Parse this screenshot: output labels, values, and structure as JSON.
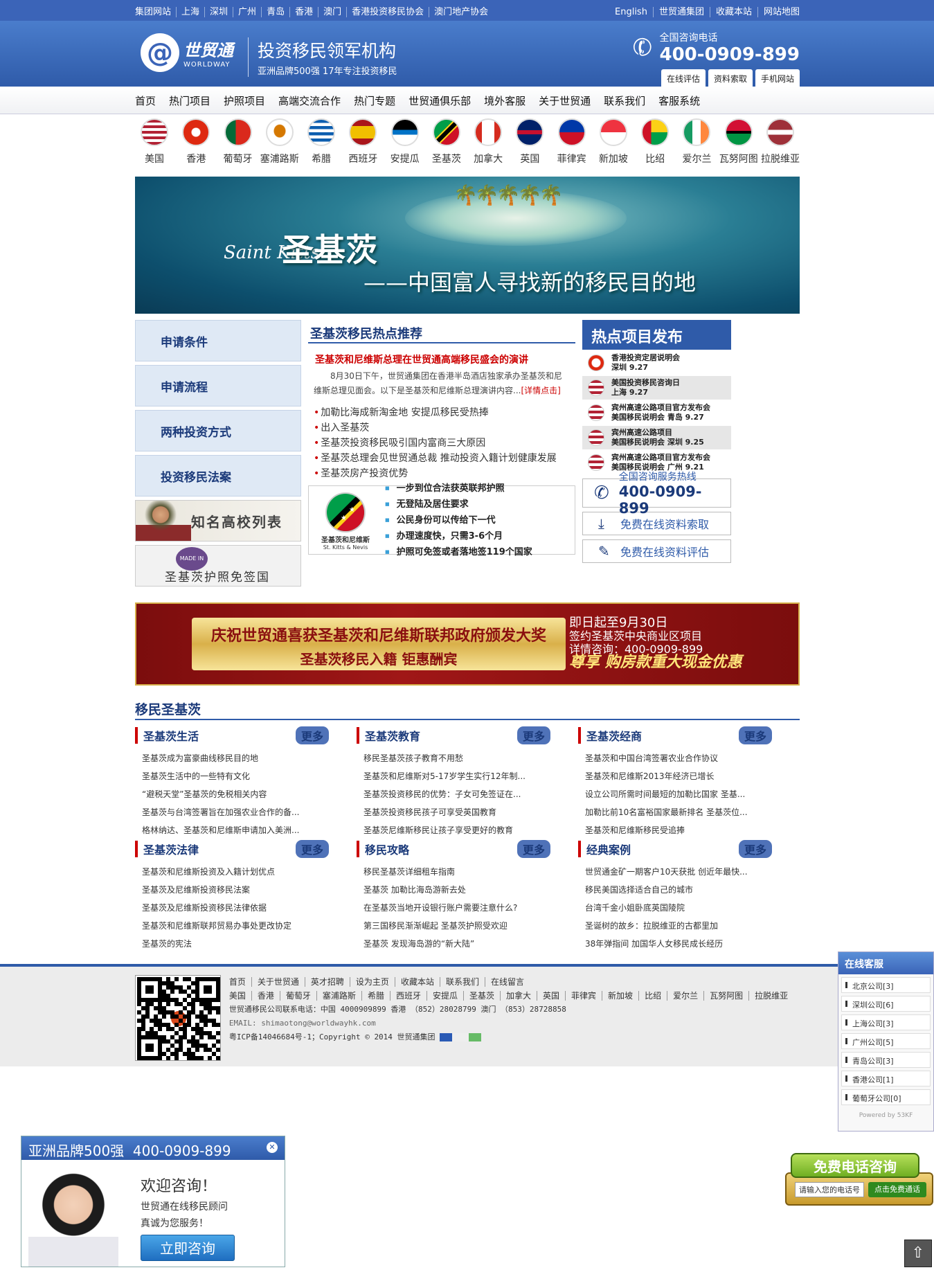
{
  "topbar": {
    "links": [
      "集团网站",
      "上海",
      "深圳",
      "广州",
      "青岛",
      "香港",
      "澳门",
      "香港投资移民协会",
      "澳门地产协会"
    ],
    "right": [
      "English",
      "世贸通集团",
      "收藏本站",
      "网站地图"
    ]
  },
  "header": {
    "logo_zh": "世贸通",
    "logo_en": "WORLDWAY",
    "slogan_main": "投资移民领军机构",
    "slogan_sub": "亚洲品牌500强  17年专注投资移民",
    "hotline_label": "全国咨询电话",
    "hotline_number": "400-0909-899",
    "tabs": [
      "在线评估",
      "资料索取",
      "手机网站"
    ]
  },
  "nav": [
    "首页",
    "热门项目",
    "护照项目",
    "高端交流合作",
    "热门专题",
    "世贸通俱乐部",
    "境外客服",
    "关于世贸通",
    "联系我们",
    "客服系统"
  ],
  "flags": [
    {
      "name": "美国",
      "icon": "us-flag-icon"
    },
    {
      "name": "香港",
      "icon": "hk-flag-icon"
    },
    {
      "name": "葡萄牙",
      "icon": "pt-flag-icon"
    },
    {
      "name": "塞浦路斯",
      "icon": "cy-flag-icon"
    },
    {
      "name": "希腊",
      "icon": "gr-flag-icon"
    },
    {
      "name": "西班牙",
      "icon": "es-flag-icon"
    },
    {
      "name": "安提瓜",
      "icon": "ag-flag-icon"
    },
    {
      "name": "圣基茨",
      "icon": "kn-flag-icon"
    },
    {
      "name": "加拿大",
      "icon": "ca-flag-icon"
    },
    {
      "name": "英国",
      "icon": "gb-flag-icon"
    },
    {
      "name": "菲律宾",
      "icon": "ph-flag-icon"
    },
    {
      "name": "新加坡",
      "icon": "sg-flag-icon"
    },
    {
      "name": "比绍",
      "icon": "gw-flag-icon"
    },
    {
      "name": "爱尔兰",
      "icon": "ie-flag-icon"
    },
    {
      "name": "瓦努阿图",
      "icon": "vu-flag-icon"
    },
    {
      "name": "拉脱维亚",
      "icon": "lv-flag-icon"
    }
  ],
  "banner": {
    "en": "Saint Kitts",
    "title": "圣基茨",
    "subtitle": "——中国富人寻找新的移民目的地"
  },
  "left_menu": [
    "申请条件",
    "申请流程",
    "两种投资方式",
    "投资移民法案"
  ],
  "left_images": {
    "schools": "知名高校列表",
    "visa": "圣基茨护照免签国",
    "stamp": "MADE IN CHINA"
  },
  "center": {
    "title": "圣基茨移民热点推荐",
    "news_title": "圣基茨和尼维斯总理在世贸通高端移民盛会的演讲",
    "news_desc": "8月30日下午，世贸通集团在香港半岛酒店独家承办圣基茨和尼维斯总理见面会。以下是圣基茨和尼维斯总理演讲内容...",
    "news_more": "[详情点击]",
    "list": [
      "加勒比海成新淘金地 安提瓜移民受热捧",
      "出入圣基茨",
      "圣基茨投资移民吸引国内富商三大原因",
      "圣基茨总理会见世贸通总裁 推动投资入籍计划健康发展",
      "圣基茨房产投资优势"
    ],
    "skn_name": "圣基茨和尼维斯",
    "skn_en": "St. Kitts & Nevis",
    "points": [
      "一步到位合法获英联邦护照",
      "无登陆及居住要求",
      "公民身份可以传给下一代",
      "办理速度快，只需3-6个月",
      "护照可免签或者落地签119个国家"
    ]
  },
  "right": {
    "title": "热点项目发布",
    "projects": [
      {
        "l1": "香港投资定居说明会",
        "l2": "深圳 9.27",
        "icon": "hk-flag-icon"
      },
      {
        "l1": "美国投资移民咨询日",
        "l2": "上海 9.27",
        "icon": "us-flag-icon"
      },
      {
        "l1": "宾州高速公路项目官方发布会",
        "l2": "美国移民说明会 青岛 9.27",
        "icon": "us-flag-icon"
      },
      {
        "l1": "宾州高速公路项目",
        "l2": "美国移民说明会 深圳 9.25",
        "icon": "us-flag-icon"
      },
      {
        "l1": "宾州高速公路项目官方发布会",
        "l2": "美国移民说明会 广州 9.21",
        "icon": "us-flag-icon"
      }
    ],
    "svc_label": "全国咨询服务热线",
    "svc_number": "400-0909-899",
    "btn_info": "免费在线资料索取",
    "btn_eval": "免费在线资料评估"
  },
  "promo": {
    "line1": "庆祝世贸通喜获圣基茨和尼维斯联邦政府颁发大奖",
    "line2": "圣基茨移民入籍 钜惠酬宾",
    "r1": "即日起至9月30日",
    "r2": "签约圣基茨中央商业区项目",
    "r3": "详情咨询：400-0909-899",
    "r4": "尊享 购房款重大现金优惠"
  },
  "immi": {
    "title": "移民圣基茨",
    "more": "更多",
    "cols": [
      {
        "title": "圣基茨生活",
        "items": [
          "圣基茨成为富豪曲线移民目的地",
          "圣基茨生活中的一些特有文化",
          "“避税天堂”圣基茨的免税相关内容",
          "圣基茨与台湾签署旨在加强农业合作的备...",
          "格林纳达、圣基茨和尼维斯申请加入美洲..."
        ]
      },
      {
        "title": "圣基茨教育",
        "items": [
          "移民圣基茨孩子教育不用愁",
          "圣基茨和尼维斯对5-17岁学生实行12年制...",
          "圣基茨投资移民的优势：子女可免签证在...",
          "圣基茨投资移民孩子可享受英国教育",
          "圣基茨尼维斯移民让孩子享受更好的教育"
        ]
      },
      {
        "title": "圣基茨经商",
        "items": [
          "圣基茨和中国台湾签署农业合作协议",
          "圣基茨和尼维斯2013年经济已增长",
          "设立公司所需时间最短的加勒比国家 圣基...",
          "加勒比前10名富裕国家最新排名 圣基茨位...",
          "圣基茨和尼维斯移民受追捧"
        ]
      },
      {
        "title": "圣基茨法律",
        "items": [
          "圣基茨和尼维斯投资及入籍计划优点",
          "圣基茨及尼维斯投资移民法案",
          "圣基茨及尼维斯投资移民法律依据",
          "圣基茨和尼维斯联邦贸易办事处更改协定",
          "圣基茨的宪法"
        ]
      },
      {
        "title": "移民攻略",
        "items": [
          "移民圣基茨详细租车指南",
          "圣基茨 加勒比海岛游新去处",
          "在圣基茨当地开设银行账户需要注意什么?",
          "第三国移民渐渐崛起 圣基茨护照受欢迎",
          "圣基茨 发现海岛游的“新大陆”"
        ]
      },
      {
        "title": "经典案例",
        "items": [
          "世贸通金矿一期客户10天获批 创近年最快...",
          "移民美国选择适合自己的城市",
          "台湾千金小姐卧底英国陵院",
          "圣诞树的故乡：拉脱维亚的古都里加",
          "38年弹指间 加国华人女移民成长经历"
        ]
      }
    ]
  },
  "footer": {
    "links": [
      "首页",
      "关于世贸通",
      "英才招聘",
      "设为主页",
      "收藏本站",
      "联系我们",
      "在线留言"
    ],
    "countries": [
      "美国",
      "香港",
      "葡萄牙",
      "塞浦路斯",
      "希腊",
      "西班牙",
      "安提瓜",
      "圣基茨",
      "加拿大",
      "英国",
      "菲律宾",
      "新加坡",
      "比绍",
      "爱尔兰",
      "瓦努阿图",
      "拉脱维亚"
    ],
    "contact": "世贸通移民公司联系电话：中国 4000909899 香港 （852）28028799 澳门 （853）28728858",
    "email": "EMAIL: shimaotong@worldwayhk.com",
    "icp": "粤ICP备14046684号-1；Copyright © 2014 世贸通集团"
  },
  "kf": {
    "title": "在线客服",
    "items": [
      "北京公司[3]",
      "深圳公司[6]",
      "上海公司[3]",
      "广州公司[5]",
      "青岛公司[3]",
      "香港公司[1]",
      "葡萄牙公司[0]"
    ],
    "powered": "Powered by 53KF"
  },
  "welcome": {
    "header": "亚洲品牌500强",
    "phone": "400-0909-899",
    "hello": "欢迎咨询！",
    "l1": "世贸通在线移民顾问",
    "l2": "真诚为您服务！",
    "btn": "立即咨询"
  },
  "freecall": {
    "title": "免费电话咨询",
    "placeholder": "请输入您的电话号",
    "btn": "点击免费通话"
  },
  "colors": {
    "brand_blue": "#2f5ba9",
    "accent_red": "#cc0000"
  }
}
